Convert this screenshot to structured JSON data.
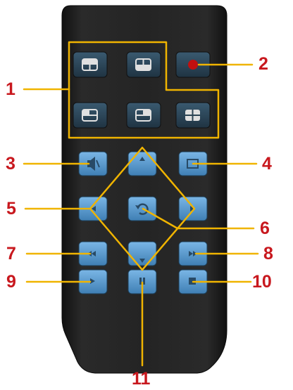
{
  "colors": {
    "callout_text": "#c8181e",
    "callout_line": "#f0b400",
    "remote_body": "#1f1f1f",
    "button_blue": "#5b9bd0",
    "button_dark": "#2c4454",
    "record_red": "#c01010"
  },
  "callouts": [
    {
      "id": "1",
      "label": "1",
      "target": "view-mode-buttons"
    },
    {
      "id": "2",
      "label": "2",
      "target": "record-button"
    },
    {
      "id": "3",
      "label": "3",
      "target": "mute-button"
    },
    {
      "id": "4",
      "label": "4",
      "target": "menu-button"
    },
    {
      "id": "5",
      "label": "5",
      "target": "direction-pad"
    },
    {
      "id": "6",
      "label": "6",
      "target": "enter-button"
    },
    {
      "id": "7",
      "label": "7",
      "target": "rewind-button"
    },
    {
      "id": "8",
      "label": "8",
      "target": "fast-forward-button"
    },
    {
      "id": "9",
      "label": "9",
      "target": "play-button"
    },
    {
      "id": "10",
      "label": "10",
      "target": "stop-button"
    },
    {
      "id": "11",
      "label": "11",
      "target": "pause-button"
    }
  ],
  "buttons": {
    "view_modes": [
      {
        "icon": "quad-view-icon"
      },
      {
        "icon": "quad-view-icon"
      },
      {
        "icon": "quad-view-icon"
      },
      {
        "icon": "quad-view-icon"
      },
      {
        "icon": "quad-view-icon"
      }
    ],
    "record": {
      "icon": "record-dot-icon"
    },
    "mute": {
      "icon": "speaker-mute-icon"
    },
    "menu": {
      "icon": "menu-square-icon"
    },
    "up": {
      "icon": "arrow-up-icon"
    },
    "down": {
      "icon": "arrow-down-icon"
    },
    "left": {
      "icon": "arrow-left-icon"
    },
    "right": {
      "icon": "arrow-right-icon"
    },
    "enter": {
      "icon": "rotate-icon"
    },
    "rewind": {
      "icon": "rewind-icon"
    },
    "fast_forward": {
      "icon": "fast-forward-icon"
    },
    "play": {
      "icon": "play-icon"
    },
    "pause": {
      "icon": "pause-icon"
    },
    "stop": {
      "icon": "stop-icon"
    }
  }
}
